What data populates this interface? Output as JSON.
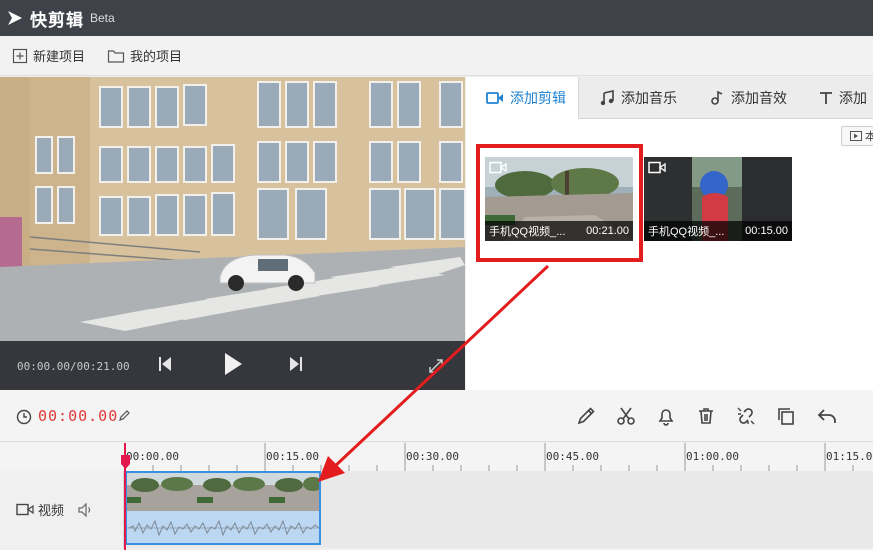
{
  "app": {
    "name": "快剪辑",
    "badge": "Beta"
  },
  "menu": {
    "new_project": "新建项目",
    "my_projects": "我的项目"
  },
  "preview": {
    "time_display": "00:00.00/00:21.00"
  },
  "tabs": [
    {
      "label": "添加剪辑",
      "icon": "video-camera-icon",
      "active": true
    },
    {
      "label": "添加音乐",
      "icon": "music-note-icon"
    },
    {
      "label": "添加音效",
      "icon": "sound-effect-icon"
    },
    {
      "label": "添加",
      "icon": "text-icon"
    }
  ],
  "library": {
    "import_label": "本",
    "clips": [
      {
        "name": "手机QQ视频_...",
        "duration": "00:21.00",
        "selected": true
      },
      {
        "name": "手机QQ视频_...",
        "duration": "00:15.00"
      }
    ]
  },
  "editor": {
    "timecode": "00:00.00"
  },
  "ruler": [
    "00:00.00",
    "00:15.00",
    "00:30.00",
    "00:45.00",
    "01:00.00",
    "01:15.00"
  ],
  "track": {
    "label": "视频"
  },
  "colors": {
    "accent": "#1f82d1",
    "highlight": "#e31d1d",
    "timecode": "#e03a3a",
    "titlebar": "#3f4249"
  }
}
